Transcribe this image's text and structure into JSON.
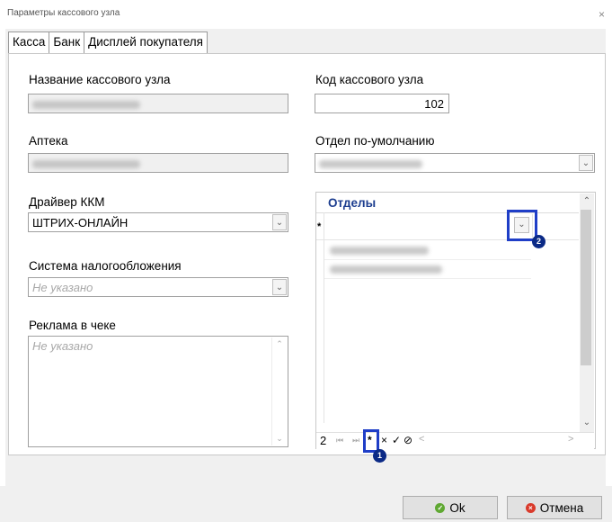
{
  "window": {
    "title": "Параметры кассового узла",
    "close_glyph": "×"
  },
  "tabs": [
    {
      "label": "Касса",
      "active": true
    },
    {
      "label": "Банк",
      "active": false
    },
    {
      "label": "Дисплей покупателя",
      "active": false
    }
  ],
  "form": {
    "node_name": {
      "label": "Название кассового узла",
      "value": ""
    },
    "node_code": {
      "label": "Код кассового узла",
      "value": "102"
    },
    "pharmacy": {
      "label": "Аптека",
      "value": ""
    },
    "default_dept": {
      "label": "Отдел по-умолчанию",
      "value": ""
    },
    "kkm_driver": {
      "label": "Драйвер ККМ",
      "value": "ШТРИХ-ОНЛАЙН"
    },
    "tax_system": {
      "label": "Система налогообложения",
      "placeholder": "Не указано"
    },
    "receipt_ad": {
      "label": "Реклама в чеке",
      "placeholder": "Не указано"
    }
  },
  "departments_grid": {
    "header": "Отделы",
    "new_row_marker": "*",
    "rows": [
      "",
      ""
    ],
    "navigator": {
      "record": "2",
      "first": "⏮",
      "last": "⏭",
      "add": "*",
      "delete": "×",
      "confirm": "✓",
      "cancel": "⊘",
      "prev_page": "<",
      "next_page": ">"
    }
  },
  "callouts": [
    {
      "number": "1"
    },
    {
      "number": "2"
    }
  ],
  "buttons": {
    "ok": "Ok",
    "cancel": "Отмена"
  },
  "colors": {
    "header_blue": "#1c3d8f",
    "callout_blue": "#0b2a86",
    "highlight": "#1f3ec7"
  }
}
